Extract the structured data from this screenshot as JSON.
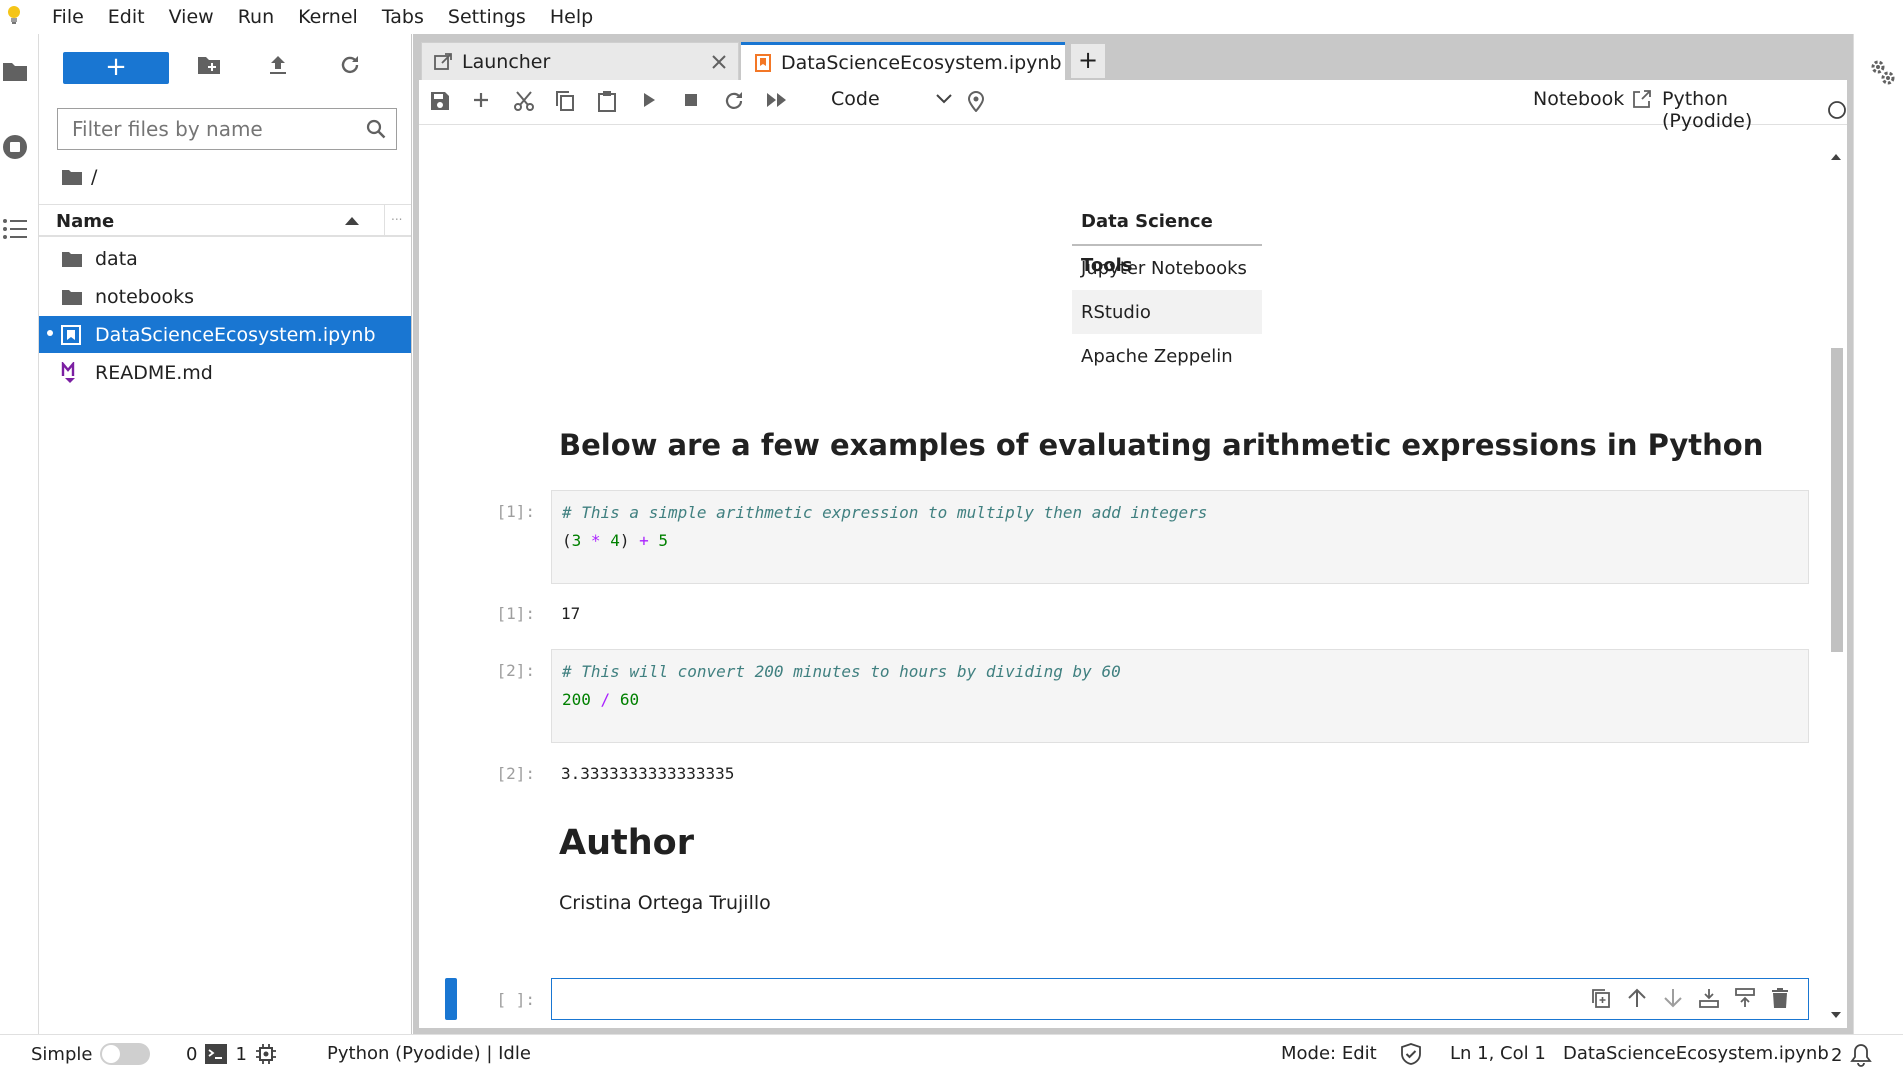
{
  "menubar": {
    "items": [
      "File",
      "Edit",
      "View",
      "Run",
      "Kernel",
      "Tabs",
      "Settings",
      "Help"
    ]
  },
  "filebrowser": {
    "new_label": "+",
    "filter_placeholder": "Filter files by name",
    "breadcrumb": "/",
    "column_name": "Name",
    "column_more": "...",
    "files": [
      {
        "name": "data",
        "icon": "folder-icon",
        "selected": false
      },
      {
        "name": "notebooks",
        "icon": "folder-icon",
        "selected": false
      },
      {
        "name": "DataScienceEcosystem.ipynb",
        "icon": "notebook-icon",
        "selected": true
      },
      {
        "name": "README.md",
        "icon": "markdown-icon",
        "selected": false
      }
    ]
  },
  "tabs": [
    {
      "label": "Launcher",
      "active": false
    },
    {
      "label": "DataScienceEcosystem.ipynb",
      "active": true
    }
  ],
  "toolbar": {
    "cell_type": "Code",
    "notebook_label": "Notebook",
    "kernel_name": "Python (Pyodide)"
  },
  "notebook": {
    "table": {
      "header": "Data Science Tools",
      "rows": [
        "Jupyter Notebooks",
        "RStudio",
        "Apache Zeppelin"
      ]
    },
    "heading_examples": "Below are a few examples of evaluating arithmetic expressions in Python",
    "cells": [
      {
        "prompt_in": "[1]:",
        "comment": "# This a simple arithmetic expression to multiply then add integers",
        "code_parts": [
          "(",
          "3",
          " * ",
          "4",
          ") ",
          "+",
          " 5"
        ],
        "prompt_out": "[1]:",
        "output": "17"
      },
      {
        "prompt_in": "[2]:",
        "comment": "# This will convert 200 minutes to hours by dividing by 60",
        "code_parts": [
          "200",
          " / ",
          "60"
        ],
        "prompt_out": "[2]:",
        "output": "3.3333333333333335"
      }
    ],
    "author_heading": "Author",
    "author_name": "Cristina Ortega Trujillo",
    "empty_prompt": "[ ]:"
  },
  "statusbar": {
    "simple_label": "Simple",
    "terminals_count": "0",
    "kernels_count": "1",
    "kernel_status": "Python (Pyodide) | Idle",
    "mode": "Mode: Edit",
    "cursor": "Ln 1, Col 1",
    "filename": "DataScienceEcosystem.ipynb",
    "notifications": "2"
  },
  "colors": {
    "accent": "#1976d2",
    "notebook_orange": "#f37726",
    "markdown_purple": "#7b1fa2"
  }
}
